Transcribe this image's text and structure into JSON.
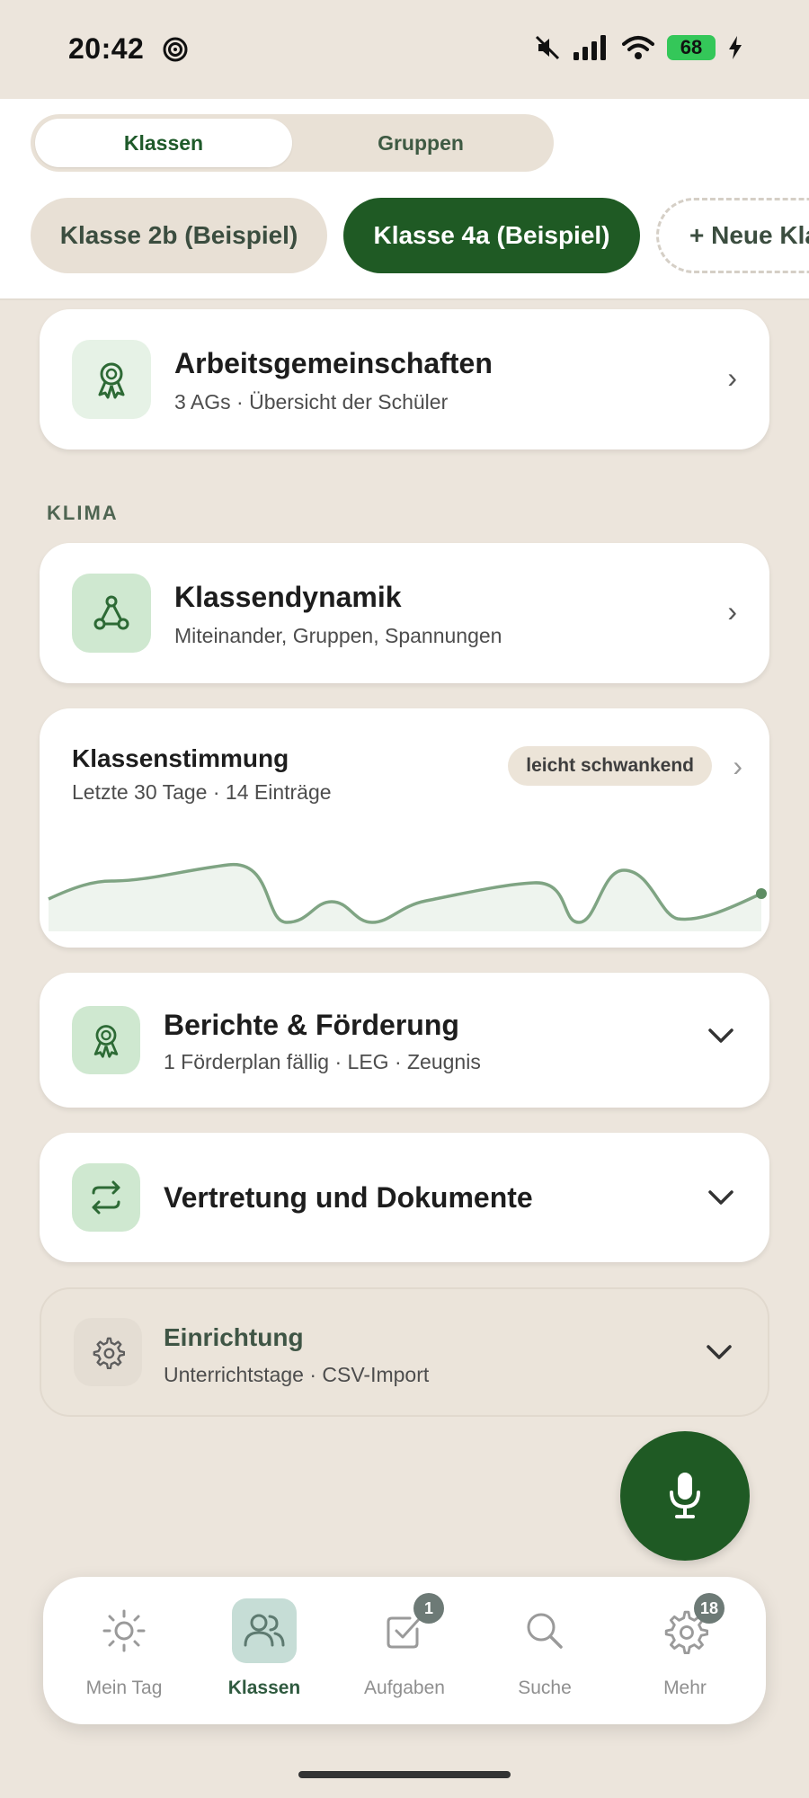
{
  "status_bar": {
    "time": "20:42",
    "battery": "68",
    "icons": [
      "spiral-icon",
      "mute-icon",
      "signal-icon",
      "wifi-icon",
      "charging-icon"
    ]
  },
  "segmented": {
    "active": "Klassen",
    "inactive": "Gruppen"
  },
  "chips": [
    "Klasse 2b (Beispiel)",
    "Klasse 4a (Beispiel)",
    "+ Neue Kla"
  ],
  "cards": {
    "ags": {
      "title": "Arbeitsgemeinschaften",
      "subtitle": "3 AGs · Übersicht der Schüler",
      "chevron": "›"
    },
    "section_klima": "KLIMA",
    "dynamik": {
      "title": "Klassendynamik",
      "subtitle": "Miteinander, Gruppen, Spannungen",
      "chevron": "›"
    },
    "stimmung": {
      "title": "Klassenstimmung",
      "subtitle": "Letzte 30 Tage · 14 Einträge",
      "badge": "leicht schwankend",
      "chevron": "›"
    },
    "berichte": {
      "title": "Berichte & Förderung",
      "subtitle": "1 Förderplan fällig · LEG · Zeugnis"
    },
    "vertretung": {
      "title": "Vertretung und Dokumente"
    },
    "einrichtung": {
      "title": "Einrichtung",
      "subtitle": "Unterrichtstage · CSV-Import"
    }
  },
  "nav": [
    {
      "label": "Mein Tag",
      "icon": "sun-icon",
      "active": false
    },
    {
      "label": "Klassen",
      "icon": "people-icon",
      "active": true
    },
    {
      "label": "Aufgaben",
      "icon": "checkbox-icon",
      "active": false,
      "badge": "1"
    },
    {
      "label": "Suche",
      "icon": "search-icon",
      "active": false
    },
    {
      "label": "Mehr",
      "icon": "gear-icon",
      "active": false,
      "badge": "18"
    }
  ],
  "colors": {
    "primary": "#1f5a24",
    "background": "#ece5dc",
    "sparkline": "#7fa483",
    "sparkline_fill": "#eef4ee"
  }
}
